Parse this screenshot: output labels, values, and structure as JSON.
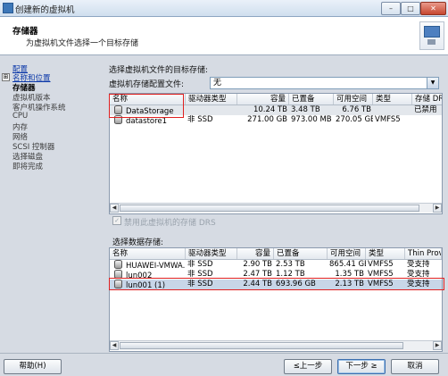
{
  "window": {
    "title": "创建新的虚拟机",
    "min_label": "–",
    "max_label": "□",
    "close_label": "✕"
  },
  "header": {
    "title": "存储器",
    "subtitle": "为虚拟机文件选择一个目标存储"
  },
  "nav": {
    "items": [
      {
        "label": "配置",
        "state": "link"
      },
      {
        "label": "名称和位置",
        "state": "link",
        "expander": "⊞"
      },
      {
        "label": "存储器",
        "state": "current"
      },
      {
        "label": "虚拟机版本",
        "state": "pending"
      },
      {
        "label": "客户机操作系统",
        "state": "pending"
      },
      {
        "label": "CPU",
        "state": "pending"
      },
      {
        "label": "内存",
        "state": "pending"
      },
      {
        "label": "网络",
        "state": "pending"
      },
      {
        "label": "SCSI 控制器",
        "state": "pending"
      },
      {
        "label": "选择磁盘",
        "state": "pending"
      },
      {
        "label": "即将完成",
        "state": "pending"
      }
    ]
  },
  "main": {
    "target_label": "选择虚拟机文件的目标存储:",
    "profile_label": "虚拟机存储配置文件:",
    "profile_value": "无",
    "drs_label": "禁用此虚拟机的存储 DRS",
    "datastore_label": "选择数据存储:"
  },
  "top_table": {
    "columns": [
      "名称",
      "驱动器类型",
      "容量",
      "已置备",
      "可用空间",
      "类型",
      "存储 DRS"
    ],
    "rows": [
      {
        "name": "DataStorage",
        "drive": "",
        "capacity": "10.24 TB",
        "provisioned": "3.48 TB",
        "free": "6.76 TB",
        "type": "",
        "drs": "已禁用"
      },
      {
        "name": "datastore1",
        "drive": "非 SSD",
        "capacity": "271.00 GB",
        "provisioned": "973.00 MB",
        "free": "270.05 GB",
        "type": "VMFS5",
        "drs": ""
      }
    ]
  },
  "bottom_table": {
    "columns": [
      "名称",
      "驱动器类型",
      "容量",
      "已置备",
      "可用空间",
      "类型",
      "Thin Provi"
    ],
    "rows": [
      {
        "name": "HUAWEI-VMWA...",
        "drive": "非 SSD",
        "capacity": "2.90 TB",
        "provisioned": "2.53 TB",
        "free": "865.41 GB",
        "type": "VMFS5",
        "thin": "受支持"
      },
      {
        "name": "lun002",
        "drive": "非 SSD",
        "capacity": "2.47 TB",
        "provisioned": "1.12 TB",
        "free": "1.35 TB",
        "type": "VMFS5",
        "thin": "受支持"
      },
      {
        "name": "lun001 (1)",
        "drive": "非 SSD",
        "capacity": "2.44 TB",
        "provisioned": "693.96 GB",
        "free": "2.13 TB",
        "type": "VMFS5",
        "thin": "受支持"
      }
    ]
  },
  "buttons": {
    "help": "帮助(H)",
    "back": "≤上一步",
    "next": "下一步 ≥",
    "cancel": "取消"
  }
}
